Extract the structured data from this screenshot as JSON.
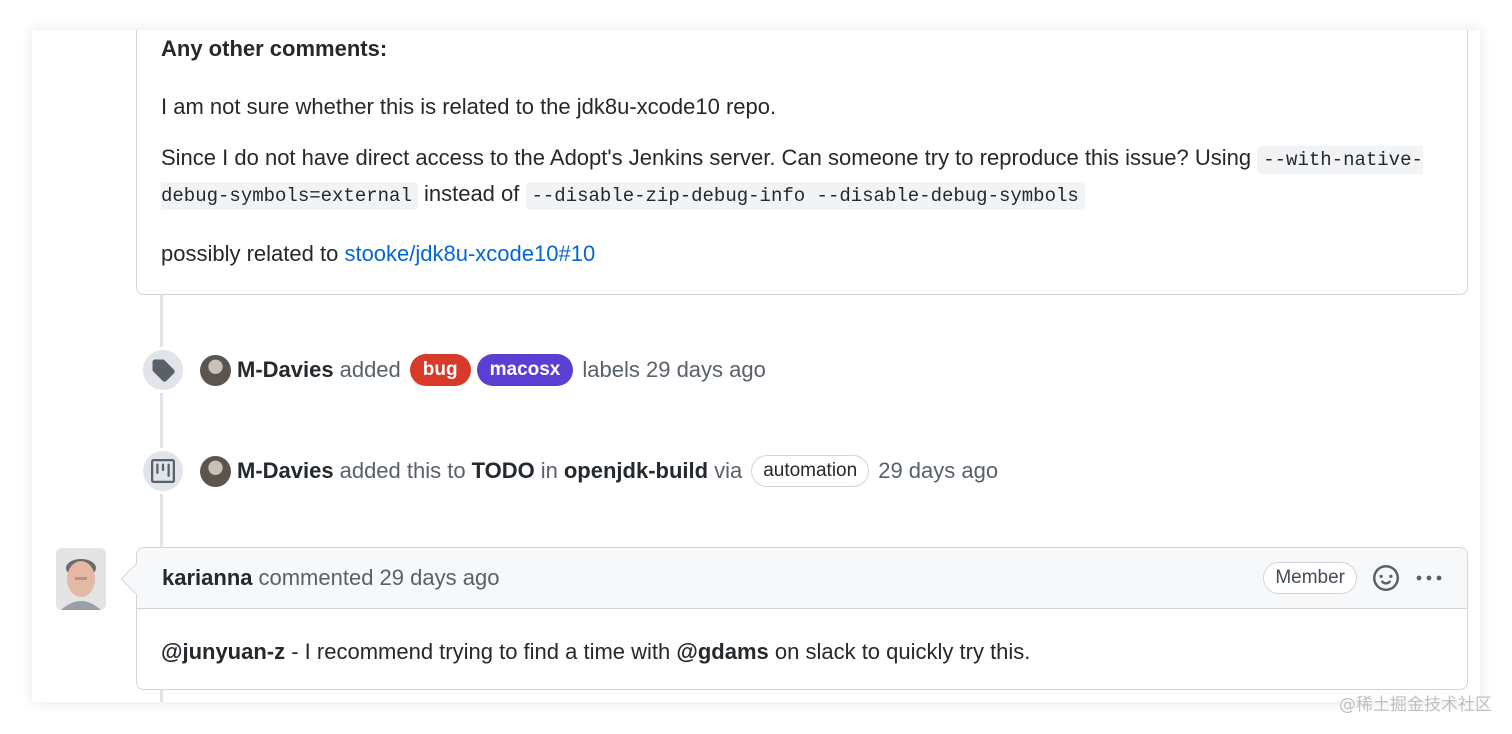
{
  "first_comment": {
    "heading": "Any other comments:",
    "paragraph1": "I am not sure whether this is related to the jdk8u-xcode10 repo.",
    "paragraph2_lead": "Since I do not have direct access to the Adopt's Jenkins server. Can someone try to reproduce this issue? Using",
    "paragraph2_code1": "--with-native-debug-symbols=external",
    "paragraph2_mid": "instead of",
    "paragraph2_code2": "--disable-zip-debug-info --disable-debug-symbols",
    "paragraph3_lead": "possibly related to",
    "paragraph3_link": "stooke/jdk8u-xcode10#10"
  },
  "event_labels": {
    "icon": "tag-icon",
    "author": "M-Davies",
    "action": "added",
    "labels": [
      {
        "text": "bug",
        "color": "#d73a29"
      },
      {
        "text": "macosx",
        "color": "#5b3fd3"
      }
    ],
    "tail": "labels 29 days ago"
  },
  "event_project": {
    "icon": "project-icon",
    "author": "M-Davies",
    "action": "added this to",
    "column": "TODO",
    "in_word": "in",
    "project": "openjdk-build",
    "via_word": "via",
    "via_pill": "automation",
    "time": "29 days ago"
  },
  "second_comment": {
    "author": "karianna",
    "action": "commented 29 days ago",
    "role_badge": "Member",
    "mention1": "@junyuan-z",
    "text1": " - I recommend trying to find a time with ",
    "mention2": "@gdams",
    "text2": " on slack to quickly try this."
  },
  "watermark": "@稀土掘金技术社区",
  "colors": {
    "link": "#0366d6",
    "border": "#d1d5da",
    "header_bg": "#f6f8fa"
  }
}
